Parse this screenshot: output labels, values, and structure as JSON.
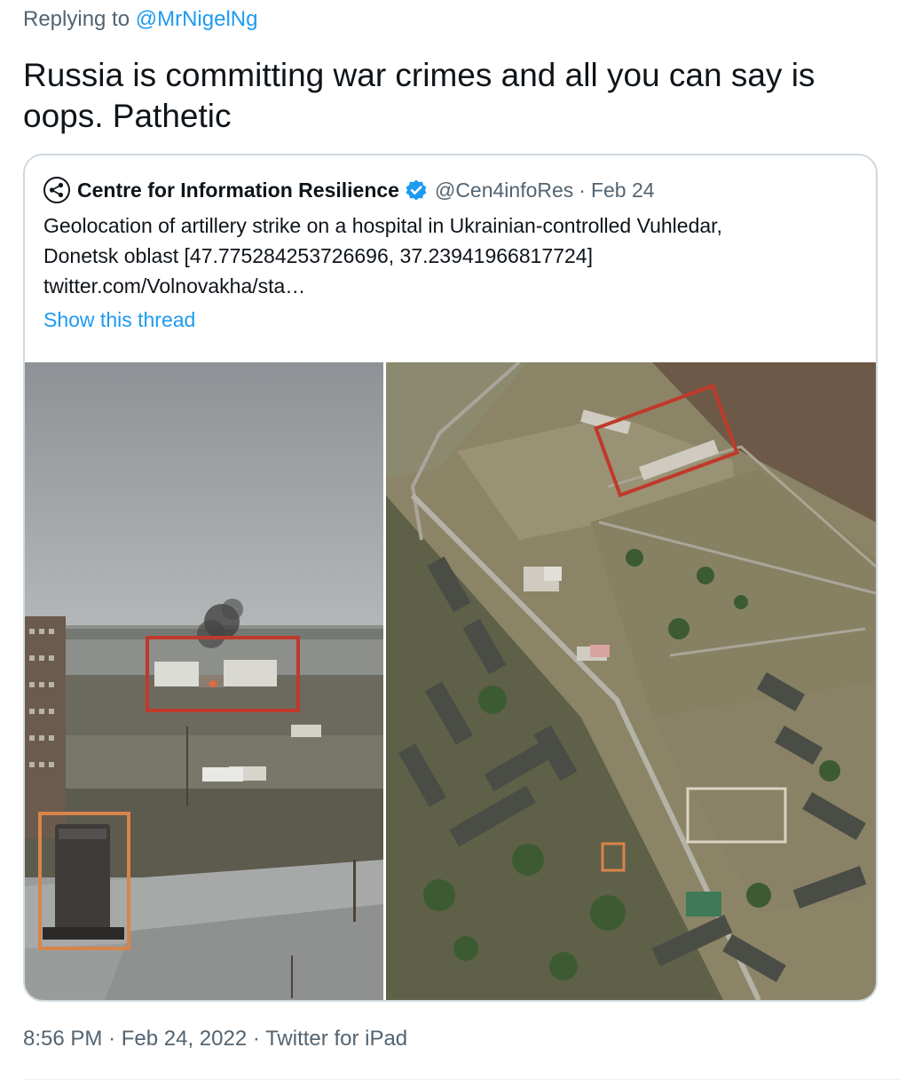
{
  "reply": {
    "prefix": "Replying to",
    "handle": "@MrNigelNg"
  },
  "tweet": {
    "text": "Russia is committing war crimes and all you can say is oops. Pathetic",
    "time": "8:56 PM",
    "date": "Feb 24, 2022",
    "source": "Twitter for iPad",
    "separator": "·"
  },
  "quote": {
    "name": "Centre for Information Resilience",
    "handle": "@Cen4infoRes",
    "date": "Feb 24",
    "separator": "·",
    "verified": true,
    "avatar_icon": "share-network-icon",
    "text_lines": [
      "Geolocation of artillery strike on a hospital in Ukrainian-controlled Vuhledar,",
      "Donetsk oblast [47.775284253726696, 37.23941966817724]",
      "twitter.com/Volnovakha/sta…"
    ],
    "show_thread": "Show this thread"
  },
  "media": {
    "left_image": "street-photo-of-smoke-over-hospital",
    "right_image": "satellite-view-of-vuhledar",
    "highlight_colors": {
      "hospital": "#c0392b",
      "monument": "#d9844a"
    }
  },
  "colors": {
    "link": "#1d9bf0",
    "secondary_text": "#536471",
    "border": "#cfd9de"
  }
}
